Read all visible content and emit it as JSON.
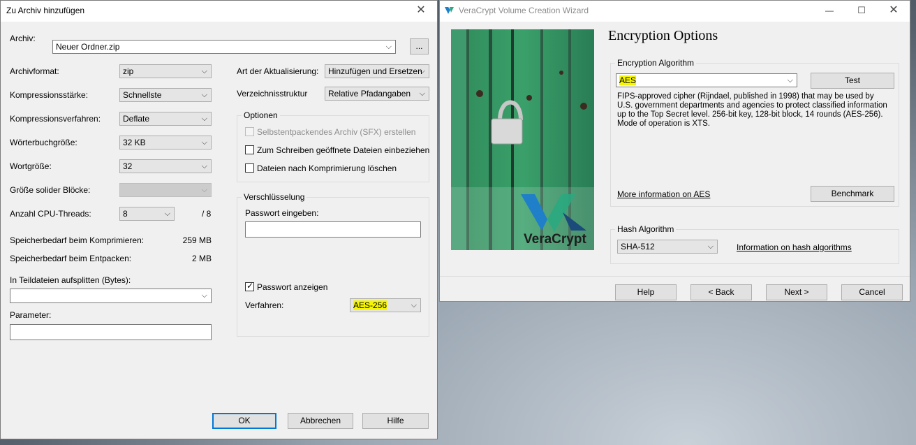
{
  "archive_dialog": {
    "title": "Zu Archiv hinzufügen",
    "close_glyph": "✕",
    "archive_label": "Archiv:",
    "archive_value": "Neuer Ordner.zip",
    "browse_label": "...",
    "rows": [
      {
        "label": "Archivformat:",
        "value": "zip"
      },
      {
        "label": "Kompressionsstärke:",
        "value": "Schnellste"
      },
      {
        "label": "Kompressionsverfahren:",
        "value": "Deflate"
      },
      {
        "label": "Wörterbuchgröße:",
        "value": "32 KB"
      },
      {
        "label": "Wortgröße:",
        "value": "32"
      },
      {
        "label": "Größe solider Blöcke:",
        "value": ""
      }
    ],
    "cpu_label": "Anzahl CPU-Threads:",
    "cpu_value": "8",
    "cpu_total": "/ 8",
    "mem_compress_label": "Speicherbedarf beim Komprimieren:",
    "mem_compress_value": "259 MB",
    "mem_extract_label": "Speicherbedarf beim Entpacken:",
    "mem_extract_value": "2 MB",
    "split_label": "In Teildateien aufsplitten (Bytes):",
    "split_value": "",
    "params_label": "Parameter:",
    "params_value": "",
    "update_label": "Art der Aktualisierung:",
    "update_value": "Hinzufügen und Ersetzen",
    "dirstruct_label": "Verzeichnisstruktur",
    "dirstruct_value": "Relative Pfadangaben",
    "options_title": "Optionen",
    "opt_sfx": "Selbstentpackendes Archiv (SFX) erstellen",
    "opt_open_files": "Zum Schreiben geöffnete Dateien einbeziehen",
    "opt_delete": "Dateien nach Komprimierung löschen",
    "encryption_title": "Verschlüsselung",
    "password_label": "Passwort eingeben:",
    "password_value": "",
    "show_password_label": "Passwort anzeigen",
    "show_password_checked": true,
    "method_label": "Verfahren:",
    "method_value": "AES-256",
    "ok_label": "OK",
    "cancel_label": "Abbrechen",
    "help_label": "Hilfe"
  },
  "veracrypt": {
    "title": "VeraCrypt Volume Creation Wizard",
    "minimize_glyph": "—",
    "maximize_glyph": "☐",
    "close_glyph": "✕",
    "logo_text": "VeraCrypt",
    "heading": "Encryption Options",
    "enc_group_title": "Encryption Algorithm",
    "enc_value": "AES",
    "test_label": "Test",
    "description": "FIPS-approved cipher (Rijndael, published in 1998) that may be used by U.S. government departments and agencies to protect classified information up to the Top Secret level. 256-bit key, 128-bit block, 14 rounds (AES-256). Mode of operation is XTS.",
    "more_info_link": "More information on AES",
    "benchmark_label": "Benchmark",
    "hash_group_title": "Hash Algorithm",
    "hash_value": "SHA-512",
    "hash_info_link": "Information on hash algorithms",
    "help_label": "Help",
    "back_label": "< Back",
    "next_label": "Next >",
    "cancel_label": "Cancel"
  },
  "colors": {
    "highlight": "#f6f600",
    "default_button_border": "#0078d7",
    "veracrypt_blue": "#1f7fc8"
  }
}
